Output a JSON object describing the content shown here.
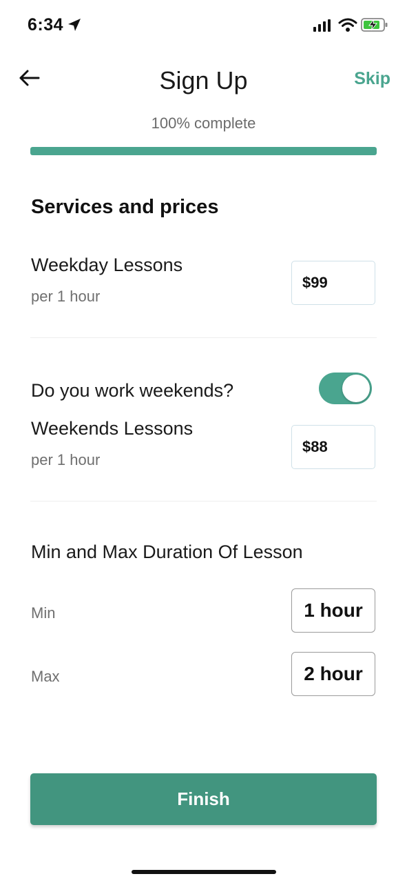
{
  "status_bar": {
    "time": "6:34",
    "icons": [
      "location-arrow-icon",
      "cellular-signal-icon",
      "wifi-icon",
      "battery-charging-icon"
    ]
  },
  "header": {
    "title": "Sign Up",
    "skip_label": "Skip",
    "back_icon": "arrow-left-icon"
  },
  "progress": {
    "label": "100% complete",
    "value": 1.0
  },
  "section": {
    "title": "Services and prices"
  },
  "weekday": {
    "label": "Weekday Lessons",
    "sub": "per 1 hour",
    "price": "$99"
  },
  "weekend_toggle": {
    "label": "Do you work weekends?",
    "on": true
  },
  "weekend": {
    "label": "Weekends Lessons",
    "sub": "per 1 hour",
    "price": "$88"
  },
  "duration": {
    "title": "Min and Max Duration Of Lesson",
    "min_label": "Min",
    "min_value": "1 hour",
    "max_label": "Max",
    "max_value": "2 hour"
  },
  "finish_label": "Finish",
  "colors": {
    "accent": "#4aa58f",
    "button": "#42957f"
  }
}
